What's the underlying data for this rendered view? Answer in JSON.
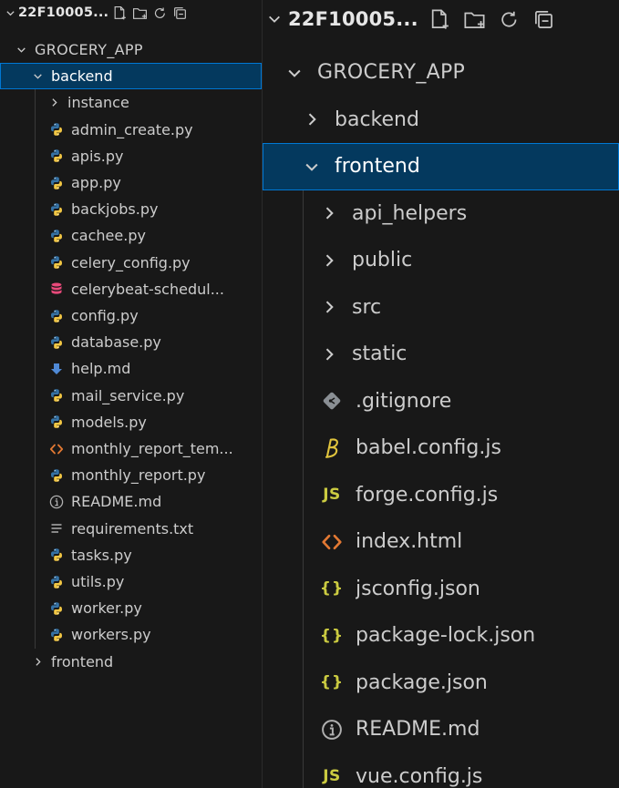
{
  "colors": {
    "background": "#181818",
    "selection_bg": "#04395e",
    "selection_border": "#0078d4",
    "text": "#cccccc",
    "python": "#3572a5",
    "python_yellow": "#f2c744",
    "database": "#e8497a",
    "markdown": "#4f89d6",
    "html": "#e37933",
    "json": "#cbcb41",
    "js": "#cbcb41",
    "babel": "#e0c43d",
    "git": "#8a8f94",
    "info": "#b0b0b0"
  },
  "left": {
    "header": {
      "title": "22F10005...",
      "actions": [
        {
          "name": "new-file",
          "icon": "new-file-icon"
        },
        {
          "name": "new-folder",
          "icon": "new-folder-icon"
        },
        {
          "name": "refresh",
          "icon": "refresh-icon"
        },
        {
          "name": "collapse-all",
          "icon": "collapse-all-icon"
        }
      ]
    },
    "items": [
      {
        "label": "GROCERY_APP",
        "type": "root",
        "expanded": true,
        "depth": 0
      },
      {
        "label": "backend",
        "type": "folder",
        "expanded": true,
        "depth": 1,
        "selected": true
      },
      {
        "label": "instance",
        "type": "folder",
        "expanded": false,
        "depth": 2
      },
      {
        "label": "admin_create.py",
        "type": "python",
        "depth": 2
      },
      {
        "label": "apis.py",
        "type": "python",
        "depth": 2
      },
      {
        "label": "app.py",
        "type": "python",
        "depth": 2
      },
      {
        "label": "backjobs.py",
        "type": "python",
        "depth": 2
      },
      {
        "label": "cachee.py",
        "type": "python",
        "depth": 2
      },
      {
        "label": "celery_config.py",
        "type": "python",
        "depth": 2
      },
      {
        "label": "celerybeat-schedul...",
        "type": "database",
        "depth": 2
      },
      {
        "label": "config.py",
        "type": "python",
        "depth": 2
      },
      {
        "label": "database.py",
        "type": "python",
        "depth": 2
      },
      {
        "label": "help.md",
        "type": "markdown",
        "depth": 2
      },
      {
        "label": "mail_service.py",
        "type": "python",
        "depth": 2
      },
      {
        "label": "models.py",
        "type": "python",
        "depth": 2
      },
      {
        "label": "monthly_report_tem...",
        "type": "html",
        "depth": 2
      },
      {
        "label": "monthly_report.py",
        "type": "python",
        "depth": 2
      },
      {
        "label": "README.md",
        "type": "info",
        "depth": 2
      },
      {
        "label": "requirements.txt",
        "type": "text",
        "depth": 2
      },
      {
        "label": "tasks.py",
        "type": "python",
        "depth": 2
      },
      {
        "label": "utils.py",
        "type": "python",
        "depth": 2
      },
      {
        "label": "worker.py",
        "type": "python",
        "depth": 2
      },
      {
        "label": "workers.py",
        "type": "python",
        "depth": 2
      },
      {
        "label": "frontend",
        "type": "folder",
        "expanded": false,
        "depth": 1
      }
    ]
  },
  "right": {
    "header": {
      "title": "22F10005...",
      "actions": [
        {
          "name": "new-file",
          "icon": "new-file-icon"
        },
        {
          "name": "new-folder",
          "icon": "new-folder-icon"
        },
        {
          "name": "refresh",
          "icon": "refresh-icon"
        },
        {
          "name": "collapse-all",
          "icon": "collapse-all-icon"
        }
      ]
    },
    "items": [
      {
        "label": "GROCERY_APP",
        "type": "root",
        "expanded": true,
        "depth": 0
      },
      {
        "label": "backend",
        "type": "folder",
        "expanded": false,
        "depth": 1
      },
      {
        "label": "frontend",
        "type": "folder",
        "expanded": true,
        "depth": 1,
        "selected": true
      },
      {
        "label": "api_helpers",
        "type": "folder",
        "expanded": false,
        "depth": 2
      },
      {
        "label": "public",
        "type": "folder",
        "expanded": false,
        "depth": 2
      },
      {
        "label": "src",
        "type": "folder",
        "expanded": false,
        "depth": 2
      },
      {
        "label": "static",
        "type": "folder",
        "expanded": false,
        "depth": 2
      },
      {
        "label": ".gitignore",
        "type": "git",
        "depth": 2
      },
      {
        "label": "babel.config.js",
        "type": "babel",
        "depth": 2
      },
      {
        "label": "forge.config.js",
        "type": "js",
        "depth": 2
      },
      {
        "label": "index.html",
        "type": "html",
        "depth": 2
      },
      {
        "label": "jsconfig.json",
        "type": "json",
        "depth": 2
      },
      {
        "label": "package-lock.json",
        "type": "json",
        "depth": 2
      },
      {
        "label": "package.json",
        "type": "json",
        "depth": 2
      },
      {
        "label": "README.md",
        "type": "info",
        "depth": 2
      },
      {
        "label": "vue.config.js",
        "type": "js",
        "depth": 2
      }
    ]
  }
}
